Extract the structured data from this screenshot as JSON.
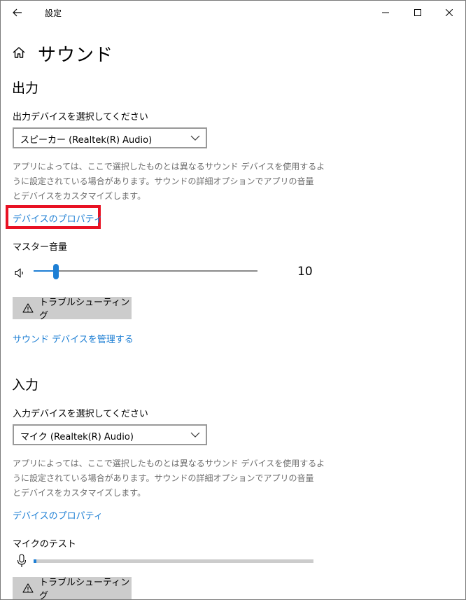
{
  "window": {
    "app_title": "設定",
    "page_title": "サウンド"
  },
  "output": {
    "section_title": "出力",
    "device_label": "出力デバイスを選択してください",
    "device_value": "スピーカー (Realtek(R) Audio)",
    "description_line1": "アプリによっては、ここで選択したものとは異なるサウンド デバイスを使用するよ",
    "description_line2": "うに設定されている場合があります。サウンドの詳細オプションでアプリの音量",
    "description_line3": "とデバイスをカスタマイズします。",
    "properties_link": "デバイスのプロパティ",
    "master_volume_label": "マスター音量",
    "volume_value": "10",
    "volume_percent": 10,
    "troubleshoot_label": "トラブルシューティング",
    "manage_devices_link": "サウンド デバイスを管理する"
  },
  "input": {
    "section_title": "入力",
    "device_label": "入力デバイスを選択してください",
    "device_value": "マイク (Realtek(R) Audio)",
    "description_line1": "アプリによっては、ここで選択したものとは異なるサウンド デバイスを使用するよ",
    "description_line2": "うに設定されている場合があります。サウンドの詳細オプションでアプリの音量",
    "description_line3": "とデバイスをカスタマイズします。",
    "properties_link": "デバイスのプロパティ",
    "mic_test_label": "マイクのテスト",
    "mic_level_percent": 1,
    "troubleshoot_label": "トラブルシューティング"
  },
  "colors": {
    "accent": "#1e7fd4",
    "highlight": "#e81123",
    "button_bg": "#cccccc",
    "description_text": "#6d6d6d"
  },
  "icons": {
    "back": "arrow-left-icon",
    "minimize": "minimize-icon",
    "maximize": "maximize-icon",
    "close": "close-icon",
    "home": "home-icon",
    "chevron": "chevron-down-icon",
    "volume": "speaker-icon",
    "warning": "warning-icon",
    "microphone": "microphone-icon"
  }
}
